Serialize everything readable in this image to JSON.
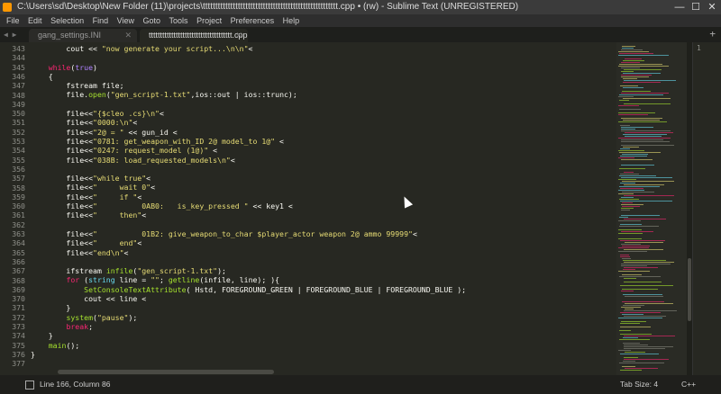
{
  "window": {
    "title": "C:\\Users\\sd\\Desktop\\New Folder (11)\\projects\\tttttttttttttttttttttttttttttttttttttttttttttttttttttt.cpp • (rw) - Sublime Text (UNREGISTERED)",
    "minimize": "—",
    "maximize": "☐",
    "close": "✕"
  },
  "menu": [
    "File",
    "Edit",
    "Selection",
    "Find",
    "View",
    "Goto",
    "Tools",
    "Project",
    "Preferences",
    "Help"
  ],
  "tabs": [
    {
      "label": "gang_settings.INI",
      "close": "✕"
    },
    {
      "label": "ttttttttttttttttttttttttttttttttttttt.cpp",
      "close": "✕"
    }
  ],
  "tab_nav": "◀ ▶",
  "tab_add": "+",
  "right_pane_line": "1",
  "lines": [
    {
      "n": "343",
      "html": "        cout << <span class=\"str\">\"now generate your script...\\n\\n\"</span><<endl;"
    },
    {
      "n": "344",
      "html": ""
    },
    {
      "n": "345",
      "html": "    <span class=\"kw\">while</span>(<span class=\"num\">true</span>)"
    },
    {
      "n": "346",
      "html": "    {"
    },
    {
      "n": "347",
      "html": "        fstream file;"
    },
    {
      "n": "348",
      "html": "        file.<span class=\"fn\">open</span>(<span class=\"str\">\"gen_script-1.txt\"</span>,ios::out | ios::trunc);"
    },
    {
      "n": "349",
      "html": ""
    },
    {
      "n": "350",
      "html": "        file<<<span class=\"str\">\"{$cleo .cs}\\n\"</span><<endl;"
    },
    {
      "n": "351",
      "html": "        file<<<span class=\"str\">\"0000:\\n\"</span><<endl;"
    },
    {
      "n": "352",
      "html": "        file<<<span class=\"str\">\"2@ = \"</span> << gun_id <<endl;"
    },
    {
      "n": "353",
      "html": "        file<<<span class=\"str\">\"0781: get_weapon_with_ID 2@ model_to 1@\"</span> <<endl;"
    },
    {
      "n": "354",
      "html": "        file<<<span class=\"str\">\"0247: request_model (1@)\"</span> <<endl;"
    },
    {
      "n": "355",
      "html": "        file<<<span class=\"str\">\"038B: load_requested_models\\n\"</span><<endl;"
    },
    {
      "n": "356",
      "html": ""
    },
    {
      "n": "357",
      "html": "        file<<<span class=\"str\">\"while true\"</span><<endl;"
    },
    {
      "n": "358",
      "html": "        file<<<span class=\"str\">\"     wait 0\"</span><<endl;"
    },
    {
      "n": "359",
      "html": "        file<<<span class=\"str\">\"     if \"</span><<endl;"
    },
    {
      "n": "360",
      "html": "        file<<<span class=\"str\">\"          0AB0:   is_key_pressed \"</span> << key1 <<endl;"
    },
    {
      "n": "361",
      "html": "        file<<<span class=\"str\">\"     then\"</span><<endl;"
    },
    {
      "n": "362",
      "html": ""
    },
    {
      "n": "363",
      "html": "        file<<<span class=\"str\">\"          01B2: give_weapon_to_char $player_actor weapon 2@ ammo 99999\"</span><<endl;"
    },
    {
      "n": "364",
      "html": "        file<<<span class=\"str\">\"     end\"</span><<endl;"
    },
    {
      "n": "365",
      "html": "        file<<<span class=\"str\">\"end\\n\"</span><<endl;"
    },
    {
      "n": "366",
      "html": ""
    },
    {
      "n": "367",
      "html": "        ifstream <span class=\"fn\">infile</span>(<span class=\"str\">\"gen_script-1.txt\"</span>);"
    },
    {
      "n": "368",
      "html": "        <span class=\"kw\">for</span> (<span class=\"cy\">string</span> line = <span class=\"str\">\"\"</span>; <span class=\"fn\">getline</span>(infile, line); ){"
    },
    {
      "n": "369",
      "html": "            <span class=\"fn\">SetConsoleTextAttribute</span>( Hstd, FOREGROUND_GREEN | FOREGROUND_BLUE | FOREGROUND_BLUE );"
    },
    {
      "n": "370",
      "html": "            cout << line <<endl;"
    },
    {
      "n": "371",
      "html": "        }"
    },
    {
      "n": "372",
      "html": "        <span class=\"fn\">system</span>(<span class=\"str\">\"pause\"</span>);"
    },
    {
      "n": "373",
      "html": "        <span class=\"kw\">break</span>;"
    },
    {
      "n": "374",
      "html": "    }"
    },
    {
      "n": "375",
      "html": "    <span class=\"fn\">main</span>();"
    },
    {
      "n": "376",
      "html": "}"
    },
    {
      "n": "377",
      "html": ""
    }
  ],
  "status": {
    "position": "Line 166, Column 86",
    "tab_size": "Tab Size: 4",
    "syntax": "C++"
  },
  "colors": {
    "background": "#272822",
    "keyword": "#f92672",
    "string": "#e6db74",
    "function": "#a6e22e",
    "number": "#ae81ff",
    "type": "#66d9ef"
  }
}
